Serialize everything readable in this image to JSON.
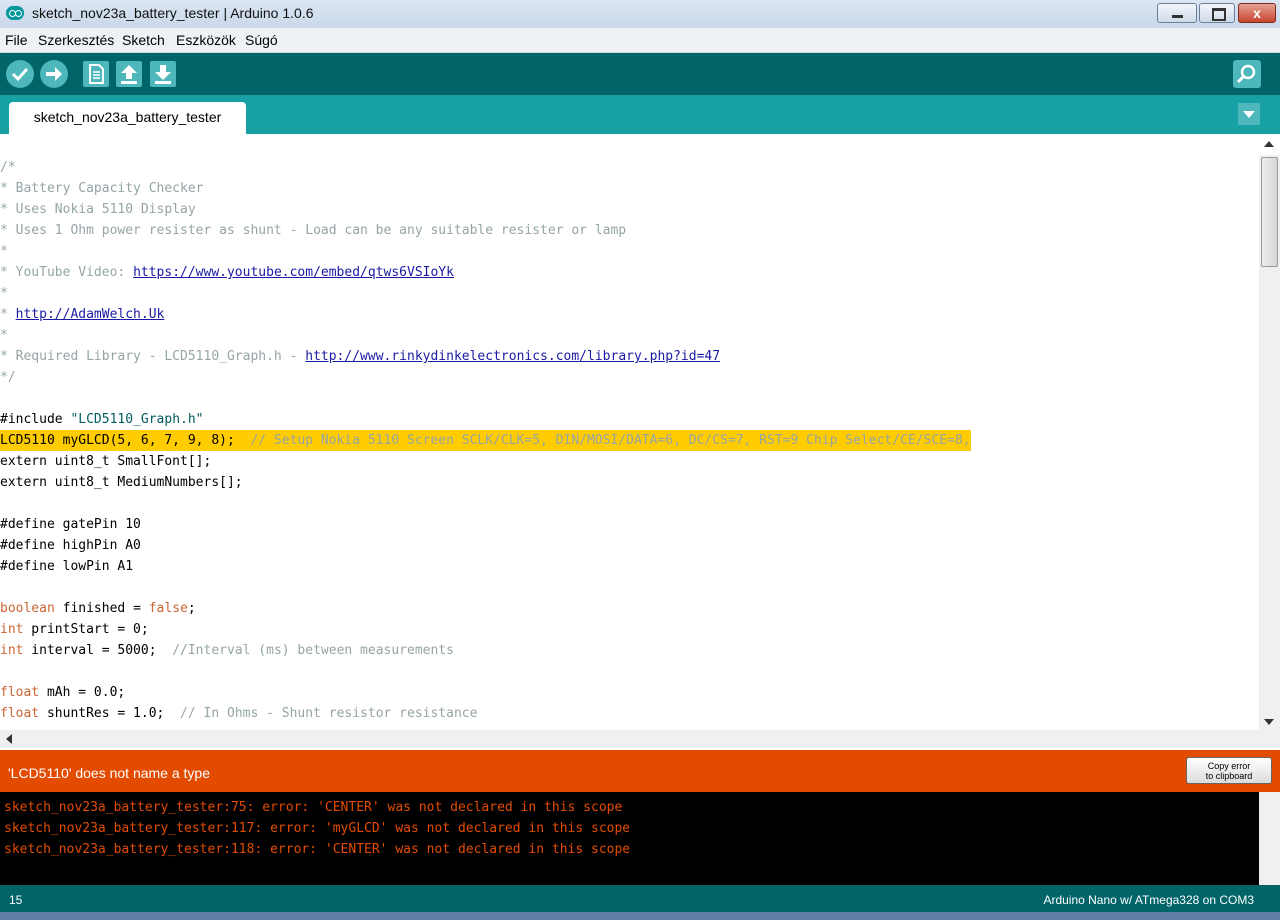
{
  "window": {
    "title": "sketch_nov23a_battery_tester | Arduino 1.0.6",
    "close_label": "x"
  },
  "menu": [
    "File",
    "Szerkesztés",
    "Sketch",
    "Eszközök",
    "Súgó"
  ],
  "toolbar": {
    "icons": [
      "verify-icon",
      "upload-icon",
      "new-icon",
      "open-icon",
      "save-icon",
      "serial-monitor-icon"
    ]
  },
  "tab": {
    "label": "sketch_nov23a_battery_tester"
  },
  "code": {
    "l1": "/*",
    "l2": "* Battery Capacity Checker",
    "l3": "* Uses Nokia 5110 Display",
    "l4": "* Uses 1 Ohm power resister as shunt - Load can be any suitable resister or lamp",
    "l5": "*",
    "l6a": "* YouTube Video: ",
    "l6b": "https://www.youtube.com/embed/qtws6VSIoYk",
    "l7": "*",
    "l8a": "* ",
    "l8b": "http://AdamWelch.Uk",
    "l9": "*",
    "l10a": "* Required Library - LCD5110_Graph.h - ",
    "l10b": "http://www.rinkydinkelectronics.com/library.php?id=47",
    "l11": "*/",
    "l13a": "#include ",
    "l13b": "\"LCD5110_Graph.h\"",
    "l14a": "LCD5110 myGLCD(5, 6, 7, 9, 8);  ",
    "l14b": "// Setup Nokia 5110 Screen SCLK/CLK=5, DIN/MOSI/DATA=6, DC/CS=7, RST=9 Chip Select/CE/SCE=8,",
    "l15": "extern uint8_t SmallFont[];",
    "l16": "extern uint8_t MediumNumbers[];",
    "l18": "#define gatePin 10",
    "l19": "#define highPin A0",
    "l20": "#define lowPin A1",
    "l22a": "boolean",
    "l22b": " finished = ",
    "l22c": "false",
    "l22d": ";",
    "l23a": "int",
    "l23b": " printStart = 0;",
    "l24a": "int",
    "l24b": " interval = 5000;  ",
    "l24c": "//Interval (ms) between measurements",
    "l26a": "float",
    "l26b": " mAh = 0.0;",
    "l27a": "float",
    "l27b": " shuntRes = 1.0;  ",
    "l27c": "// In Ohms - Shunt resistor resistance"
  },
  "message": {
    "text": "'LCD5110' does not name a type",
    "copy_line1": "Copy error",
    "copy_line2": "to clipboard"
  },
  "console": [
    "sketch_nov23a_battery_tester:75: error: 'CENTER' was not declared in this scope",
    "sketch_nov23a_battery_tester:117: error: 'myGLCD' was not declared in this scope",
    "sketch_nov23a_battery_tester:118: error: 'CENTER' was not declared in this scope"
  ],
  "status": {
    "line_number": "15",
    "board": "Arduino Nano w/ ATmega328 on COM3"
  },
  "colors": {
    "toolbar": "#006468",
    "tabstrip": "#17a1a5",
    "error_bar": "#e34c00",
    "highlight": "#ffcc00"
  }
}
